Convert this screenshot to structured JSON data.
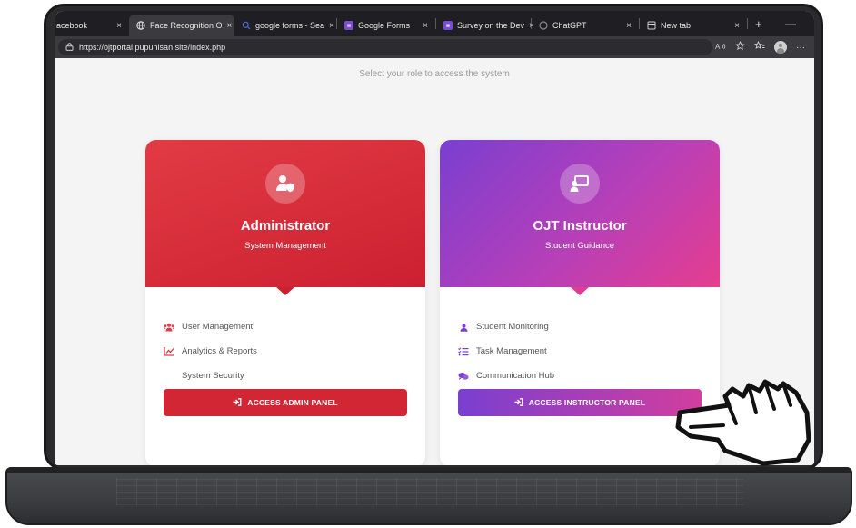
{
  "browser": {
    "tabs": [
      {
        "label": "acebook",
        "favicon": "facebook-icon",
        "active": false
      },
      {
        "label": "Face Recognition O",
        "favicon": "globe-icon",
        "active": true
      },
      {
        "label": "google forms - Sea",
        "favicon": "search-icon",
        "active": false
      },
      {
        "label": "Google Forms",
        "favicon": "forms-icon",
        "active": false
      },
      {
        "label": "Survey on the Dev",
        "favicon": "forms-icon",
        "active": false
      },
      {
        "label": "ChatGPT",
        "favicon": "chatgpt-icon",
        "active": false
      },
      {
        "label": "New tab",
        "favicon": "newtab-icon",
        "active": false
      }
    ],
    "close_glyph": "×",
    "new_tab_glyph": "+",
    "minimize_glyph": "—",
    "url": "https://ojtportal.pupunisan.site/index.php",
    "more_glyph": "···"
  },
  "page": {
    "subtitle": "Select your role to access the system"
  },
  "roles": [
    {
      "title": "Administrator",
      "subtitle": "System Management",
      "icon": "user-shield-icon",
      "features": [
        {
          "label": "User Management",
          "icon": "users-icon"
        },
        {
          "label": "Analytics & Reports",
          "icon": "chart-line-icon"
        },
        {
          "label": "System Security",
          "icon": ""
        }
      ],
      "button_label": "ACCESS ADMIN PANEL",
      "accent": "#d32634"
    },
    {
      "title": "OJT Instructor",
      "subtitle": "Student Guidance",
      "icon": "chalkboard-teacher-icon",
      "features": [
        {
          "label": "Student Monitoring",
          "icon": "student-icon"
        },
        {
          "label": "Task Management",
          "icon": "tasks-icon"
        },
        {
          "label": "Communication Hub",
          "icon": "comments-icon"
        }
      ],
      "button_label": "ACCESS INSTRUCTOR PANEL",
      "accent": "#7a3fd0"
    }
  ]
}
